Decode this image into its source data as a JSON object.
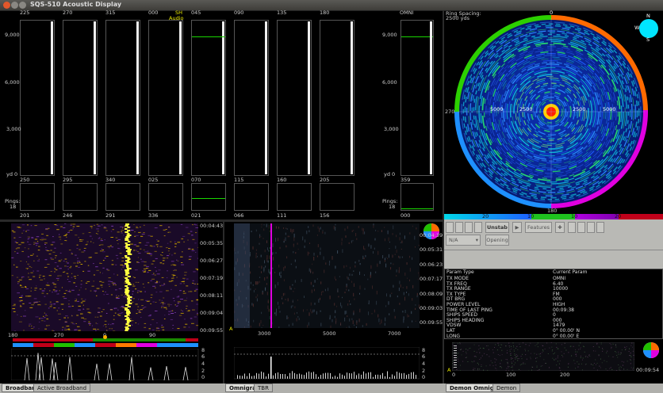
{
  "window": {
    "title": "SQS-510 Acoustic Display"
  },
  "bearing_panel": {
    "top_labels": [
      "225",
      "270",
      "315",
      "000",
      "045",
      "090",
      "135",
      "180"
    ],
    "omni_label": "OMNI",
    "sh_label": "SH",
    "audio_label": "Audio",
    "y_ticks": [
      "9,000",
      "6,000",
      "3,000",
      "yd 0"
    ],
    "omni_y_ticks": [
      "9,000",
      "6,000",
      "3,000",
      "yd 0"
    ],
    "mini_top_labels": [
      "250",
      "295",
      "340",
      "025",
      "070",
      "115",
      "160",
      "205"
    ],
    "mini_bottom_labels": [
      "201",
      "246",
      "291",
      "336",
      "021",
      "066",
      "111",
      "156"
    ],
    "omni_mini_top": "359",
    "omni_mini_bottom": "000",
    "pings_label": "Pings:",
    "pings_value": "18",
    "omni_pings_label": "Pings:",
    "omni_pings_value": "18"
  },
  "ppi": {
    "ring_spacing_label": "Ring Spacing:",
    "ring_spacing_value": "2500 yds",
    "bearing_top": "0",
    "bearing_left": "270",
    "bearing_bottom": "180",
    "range_labels": [
      "5000",
      "2500",
      "2500",
      "5000"
    ],
    "compass_n": "N",
    "compass_s": "S",
    "compass_w": "W",
    "scale_labels": [
      "20",
      "10",
      "10",
      "20"
    ],
    "colors": {
      "orange": "#ff6a00",
      "magenta": "#e000e0",
      "blue": "#1e90ff",
      "green": "#2cd000",
      "cyan": "#00e5ff"
    }
  },
  "controls": {
    "unstab_label": "Unstab",
    "features_label": "Features",
    "na_value": "N/A",
    "opening_label": "Opening"
  },
  "params": {
    "header_type": "Param Type",
    "header_value": "Current Param",
    "rows": [
      {
        "type": "TX MODE",
        "value": "OMNI"
      },
      {
        "type": "TX FREQ",
        "value": "6.40"
      },
      {
        "type": "TX RANGE",
        "value": "10000"
      },
      {
        "type": "TX TYPE",
        "value": "FM"
      },
      {
        "type": "DT BRG",
        "value": "000"
      },
      {
        "type": "POWER LEVEL",
        "value": "HIGH"
      },
      {
        "type": "TIME OF LAST PING",
        "value": "00:09:38"
      },
      {
        "type": "SHIPS SPEED",
        "value": "0"
      },
      {
        "type": "SHIPS HEADING",
        "value": "000"
      },
      {
        "type": "VDSW",
        "value": "1479"
      },
      {
        "type": "LAT",
        "value": "0° 00.00' N"
      },
      {
        "type": "LONG",
        "value": "0° 00.00' E"
      }
    ]
  },
  "broadband": {
    "times": [
      "00:04:43",
      "00:05:35",
      "00:06:27",
      "00:07:19",
      "00:08:11",
      "00:09:04",
      "00:09:55"
    ],
    "axis_labels": [
      "180",
      "270",
      "0",
      "90"
    ],
    "hist_ticks": [
      "8",
      "6",
      "4",
      "2",
      "0"
    ]
  },
  "omnigram": {
    "times": [
      "00:04:39",
      "00:05:31",
      "00:06:23",
      "00:07:17",
      "00:08:09",
      "00:09:03",
      "00:09:55"
    ],
    "axis_labels": [
      "3000",
      "5000",
      "7000"
    ],
    "hist_ticks": [
      "8",
      "6",
      "4",
      "2",
      "0"
    ],
    "a_marker": "A"
  },
  "demon": {
    "time": "00:09:54",
    "axis_labels": [
      "0",
      "100",
      "200"
    ],
    "a_marker": "A"
  },
  "tabs": {
    "broadband": "Broadband",
    "active_broadband": "Active Broadband",
    "omnigram": "Omnigram",
    "tbr": "TBR",
    "demon_omnigram": "Demon Omnigram",
    "demon": "Demon"
  }
}
